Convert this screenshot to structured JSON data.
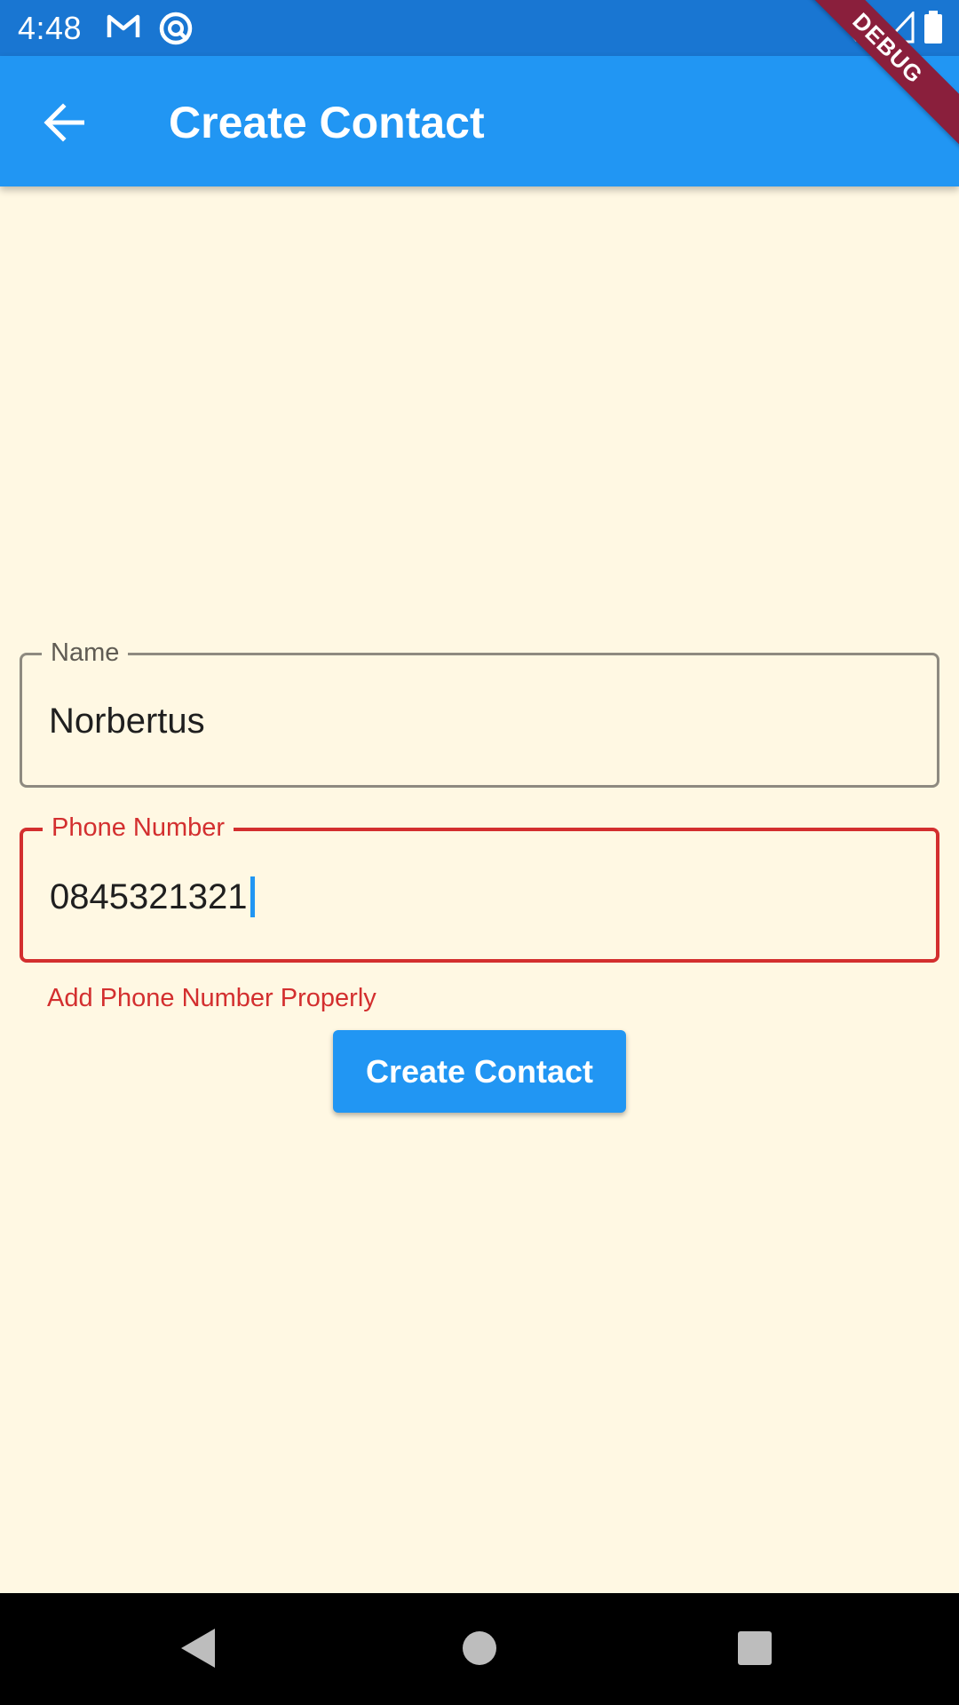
{
  "status_bar": {
    "time": "4:48",
    "icons": [
      "gmail-icon",
      "sync-icon",
      "wifi-icon",
      "signal-icon",
      "battery-icon"
    ]
  },
  "debug_banner": "DEBUG",
  "app_bar": {
    "back_icon": "arrow-back-icon",
    "title": "Create Contact"
  },
  "form": {
    "name_label": "Name",
    "name_value": "Norbertus",
    "phone_label": "Phone Number",
    "phone_value": "0845321321",
    "phone_error": "Add Phone Number Properly",
    "submit_label": "Create Contact"
  },
  "colors": {
    "primary": "#2196F3",
    "status_bar": "#1976D2",
    "background": "#FFF8E3",
    "error": "#D32F2F"
  },
  "nav_bar": {
    "icons": [
      "nav-back-icon",
      "nav-home-icon",
      "nav-recents-icon"
    ]
  }
}
